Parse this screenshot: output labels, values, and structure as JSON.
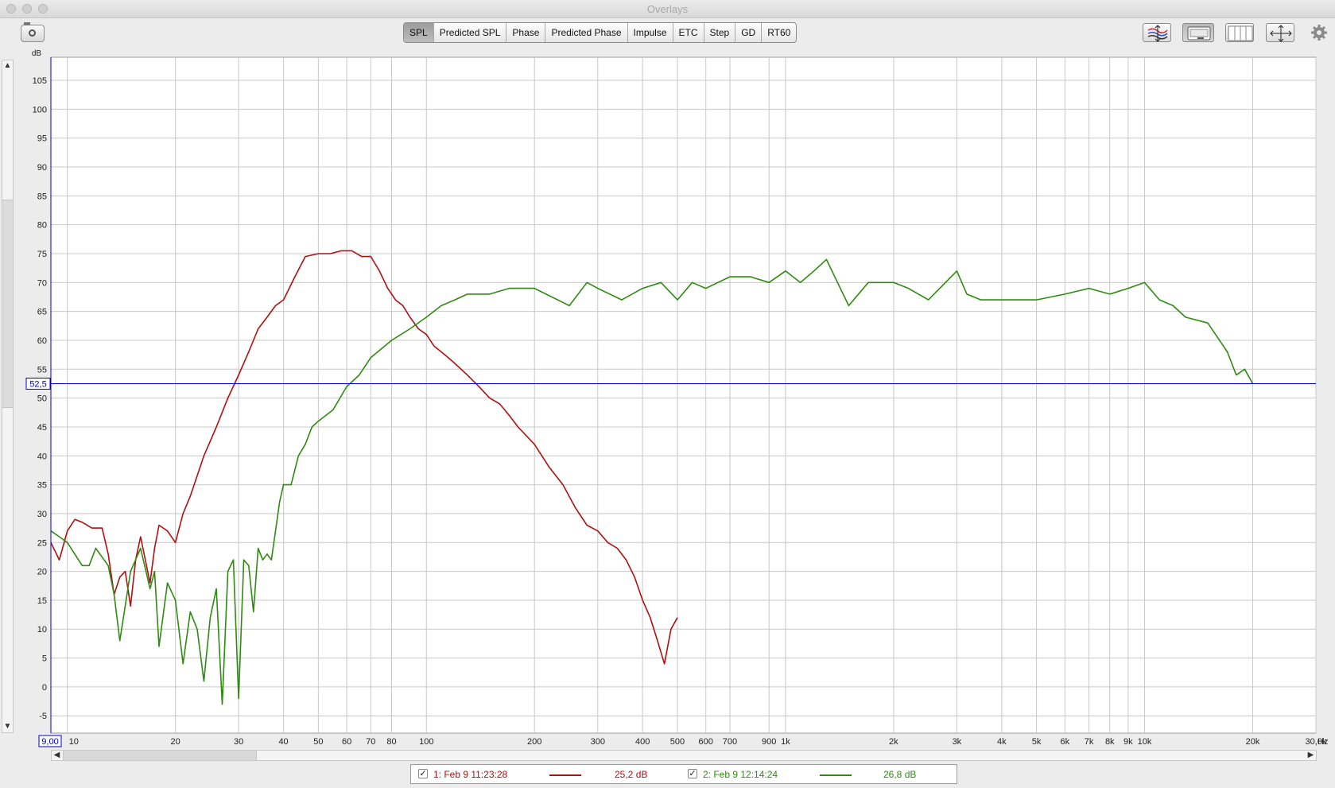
{
  "window": {
    "title": "Overlays"
  },
  "tabs": [
    {
      "label": "SPL",
      "active": true
    },
    {
      "label": "Predicted SPL",
      "active": false
    },
    {
      "label": "Phase",
      "active": false
    },
    {
      "label": "Predicted Phase",
      "active": false
    },
    {
      "label": "Impulse",
      "active": false
    },
    {
      "label": "ETC",
      "active": false
    },
    {
      "label": "Step",
      "active": false
    },
    {
      "label": "GD",
      "active": false
    },
    {
      "label": "RT60",
      "active": false
    }
  ],
  "toolbar_icons": [
    "camera-icon",
    "traces-arrange-icon",
    "controls-icon",
    "grid-lines-icon",
    "fit-to-window-icon",
    "gear-icon"
  ],
  "colors": {
    "accent": "#0000cc",
    "trace1": "#b01010",
    "trace2": "#2e8b10",
    "plot_bg": "#ffffff",
    "grid": "#c8c8c8"
  },
  "cursor": {
    "db_value": "52,5",
    "freq_value": "9,00"
  },
  "chart_data": {
    "type": "line",
    "title": "",
    "xlabel": "Hz",
    "ylabel": "dB",
    "x_scale": "log",
    "xlim": [
      9,
      30000
    ],
    "ylim": [
      -8,
      109
    ],
    "grid": true,
    "x_ticks": [
      "10",
      "20",
      "30",
      "40",
      "50",
      "60",
      "70",
      "80",
      "100",
      "200",
      "300",
      "400",
      "500",
      "600",
      "700",
      "900",
      "1k",
      "2k",
      "3k",
      "4k",
      "5k",
      "6k",
      "7k",
      "8k",
      "9k",
      "10k",
      "20k",
      "30,0k"
    ],
    "y_ticks": [
      "105",
      "100",
      "95",
      "90",
      "85",
      "80",
      "75",
      "70",
      "65",
      "60",
      "55",
      "50",
      "45",
      "40",
      "35",
      "30",
      "25",
      "20",
      "15",
      "10",
      "5",
      "0",
      "-5"
    ],
    "series": [
      {
        "name": "1: Feb 9 11:23:28",
        "color": "#b01010",
        "x": [
          9,
          9.5,
          10,
          10.5,
          11,
          11.7,
          12.5,
          13,
          13.5,
          14,
          14.5,
          15,
          15.5,
          16,
          17,
          17.5,
          18,
          19,
          20,
          21,
          22,
          24,
          26,
          28,
          30,
          32,
          34,
          36,
          38,
          40,
          43,
          46,
          50,
          54,
          58,
          62,
          66,
          70,
          74,
          78,
          82,
          86,
          90,
          95,
          100,
          105,
          110,
          115,
          120,
          130,
          140,
          150,
          160,
          170,
          180,
          200,
          220,
          240,
          260,
          280,
          300,
          320,
          340,
          360,
          380,
          400,
          420,
          440,
          460,
          480,
          500
        ],
        "y": [
          25,
          22,
          27,
          29,
          28.5,
          27.5,
          27.5,
          23,
          16,
          19,
          20,
          14,
          22,
          26,
          18,
          24,
          28,
          27,
          25,
          30,
          33,
          40,
          45,
          50,
          54,
          58,
          62,
          64,
          66,
          67,
          71,
          74.5,
          75,
          75,
          75.5,
          75.5,
          74.5,
          74.5,
          72,
          69,
          67,
          66,
          64,
          62,
          61,
          59,
          58,
          57,
          56,
          54,
          52,
          50,
          49,
          47,
          45,
          42,
          38,
          35,
          31,
          28,
          27,
          25,
          24,
          22,
          19,
          15,
          12,
          8,
          4,
          10,
          12
        ]
      },
      {
        "name": "2: Feb 9 12:14:24",
        "color": "#2e8b10",
        "x": [
          9,
          9.5,
          10,
          11,
          11.5,
          12,
          13,
          13.5,
          14,
          15,
          16,
          17,
          17.5,
          18,
          19,
          20,
          21,
          22,
          23,
          24,
          25,
          26,
          27,
          28,
          29,
          30,
          31,
          32,
          33,
          34,
          35,
          36,
          37,
          38,
          39,
          40,
          42,
          44,
          46,
          48,
          50,
          55,
          60,
          65,
          70,
          80,
          90,
          100,
          110,
          120,
          130,
          140,
          150,
          170,
          200,
          250,
          280,
          300,
          350,
          400,
          450,
          500,
          550,
          600,
          700,
          800,
          900,
          1000,
          1100,
          1200,
          1300,
          1500,
          1700,
          2000,
          2200,
          2500,
          3000,
          3200,
          3500,
          4000,
          5000,
          6000,
          7000,
          8000,
          9000,
          10000,
          11000,
          12000,
          13000,
          15000,
          17000,
          18000,
          19000,
          20000
        ],
        "y": [
          27,
          26,
          25,
          21,
          21,
          24,
          21,
          16,
          8,
          20,
          24,
          17,
          20,
          7,
          18,
          15,
          4,
          13,
          10,
          1,
          12,
          17,
          -3,
          20,
          22,
          -2,
          22,
          21,
          13,
          24,
          22,
          23,
          22,
          27,
          32,
          35,
          35,
          40,
          42,
          45,
          46,
          48,
          52,
          54,
          57,
          60,
          62,
          64,
          66,
          67,
          68,
          68,
          68,
          69,
          69,
          66,
          70,
          69,
          67,
          69,
          70,
          67,
          70,
          69,
          71,
          71,
          70,
          72,
          70,
          72,
          74,
          66,
          70,
          70,
          69,
          67,
          72,
          68,
          67,
          67,
          67,
          68,
          69,
          68,
          69,
          70,
          67,
          66,
          64,
          63,
          58,
          54,
          55,
          52.5
        ]
      }
    ],
    "legend": [
      {
        "label": "1: Feb 9 11:23:28",
        "value": "25,2 dB",
        "checked": true
      },
      {
        "label": "2: Feb 9 12:14:24",
        "value": "26,8 dB",
        "checked": true
      }
    ]
  }
}
